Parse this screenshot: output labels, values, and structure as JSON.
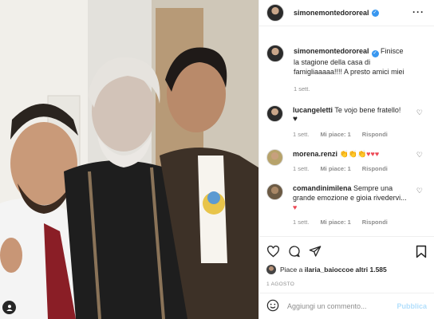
{
  "post": {
    "username": "simonemontedororeal",
    "caption_user": "simonemontedororeal",
    "caption": "Finisce la stagione della casa di famigliaaaaa!!!! A presto amici miei",
    "caption_time": "1 sett.",
    "like_prefix": "Piace a ",
    "like_user": "ilaria_baiocco",
    "like_suffix": " e altri 1.585",
    "date": "1 AGOSTO"
  },
  "comments": [
    {
      "user": "lucangeletti",
      "text": "Te vojo bene fratello!",
      "emoji": "♥",
      "time": "1 sett.",
      "likes": "Mi piace: 1",
      "reply": "Rispondi"
    },
    {
      "user": "morena.renzi",
      "text": "👏👏👏",
      "emoji": "♥♥♥",
      "time": "1 sett.",
      "likes": "Mi piace: 1",
      "reply": "Rispondi"
    },
    {
      "user": "comandinimilena",
      "text": "Sempre una grande emozione e gioia rivedervi...",
      "emoji": "♥",
      "time": "1 sett.",
      "likes": "Mi piace: 1",
      "reply": "Rispondi"
    }
  ],
  "add_comment": {
    "placeholder": "Aggiungi un commento...",
    "publish": "Pubblica"
  },
  "icons": {
    "more": "more-options-icon",
    "verified": "verified-badge-icon",
    "like": "heart-icon",
    "comment": "comment-icon",
    "share": "paper-plane-icon",
    "save": "bookmark-icon",
    "emoji": "emoji-icon",
    "tag": "user-tag-icon"
  },
  "colors": {
    "verified": "#3897f0",
    "heart": "#ed4956",
    "publish": "#b2dffc"
  }
}
